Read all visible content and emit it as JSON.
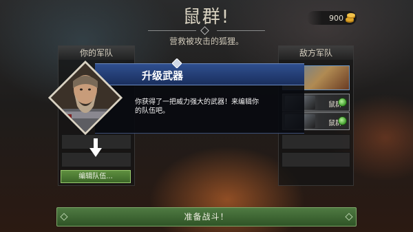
{
  "header": {
    "title": "鼠群!",
    "subtitle": "营救被攻击的狐狸。"
  },
  "currency": {
    "gold_value": "900",
    "icon": "gold-coins-icon"
  },
  "your_army": {
    "heading": "你的军队",
    "edit_button_label": "编辑队伍..."
  },
  "enemy_army": {
    "heading": "敌方军队",
    "units": [
      {
        "name": "鼠群",
        "badge_icon": "green-orb-icon"
      },
      {
        "name": "鼠群",
        "badge_icon": "green-orb-icon"
      }
    ]
  },
  "tutorial": {
    "title": "升级武器",
    "body": "你获得了一把威力强大的武器！来编辑你的队伍吧。",
    "pointer_icon": "arrow-down-icon"
  },
  "footer": {
    "ready_button_label": "准备战斗！"
  },
  "colors": {
    "accent_green": "#4f7a42",
    "popup_blue": "#2f4f8f",
    "badge_green": "#3e9a2a"
  }
}
